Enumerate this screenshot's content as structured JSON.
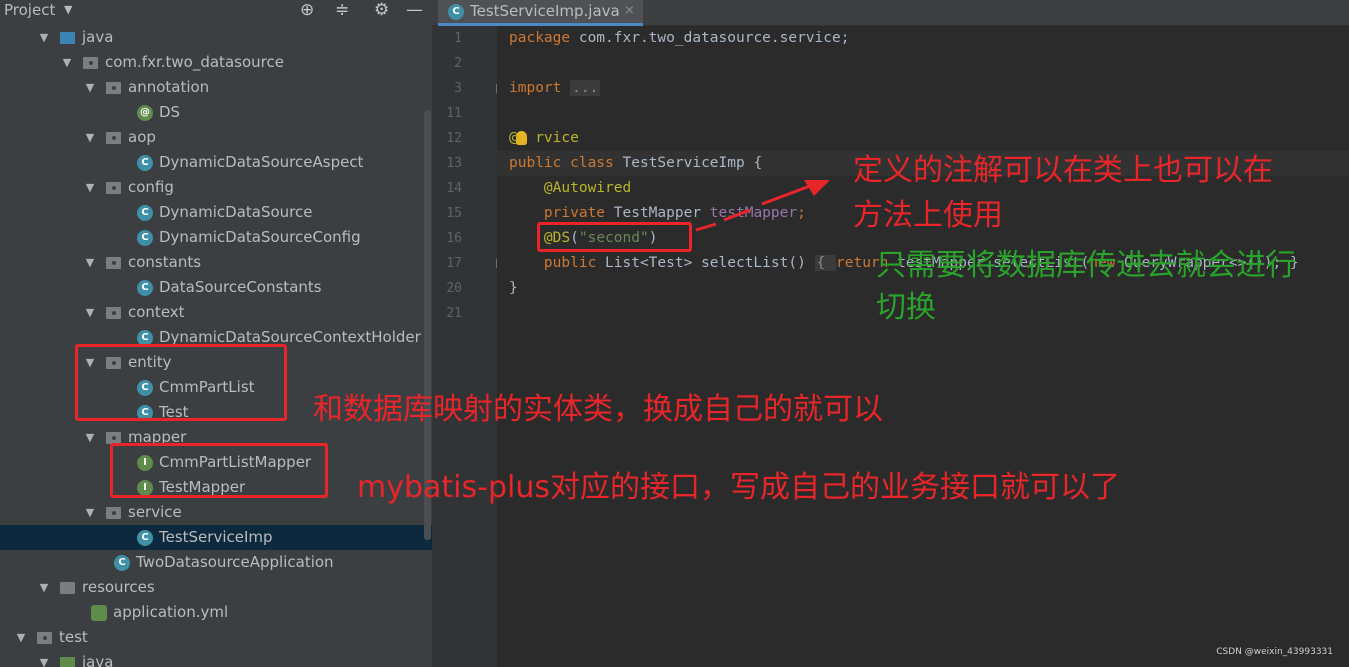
{
  "project_panel": {
    "title": "Project",
    "title_arrow": "▼",
    "header_icons": {
      "locate": "⊕",
      "collapse": "≑",
      "settings": "⚙",
      "hide": "—"
    },
    "tree": [
      {
        "indent": 0,
        "twisty": "▼",
        "icon": "folder-blue",
        "label": "java"
      },
      {
        "indent": 1,
        "twisty": "▼",
        "icon": "package",
        "label": "com.fxr.two_datasource"
      },
      {
        "indent": 2,
        "twisty": "▼",
        "icon": "package",
        "label": "annotation"
      },
      {
        "indent": 3,
        "twisty": "",
        "icon": "annotation",
        "badge": "@",
        "label": "DS"
      },
      {
        "indent": 2,
        "twisty": "▼",
        "icon": "package",
        "label": "aop"
      },
      {
        "indent": 3,
        "twisty": "",
        "icon": "class",
        "badge": "C",
        "label": "DynamicDataSourceAspect"
      },
      {
        "indent": 2,
        "twisty": "▼",
        "icon": "package",
        "label": "config"
      },
      {
        "indent": 3,
        "twisty": "",
        "icon": "class",
        "badge": "C",
        "label": "DynamicDataSource"
      },
      {
        "indent": 3,
        "twisty": "",
        "icon": "class",
        "badge": "C",
        "label": "DynamicDataSourceConfig"
      },
      {
        "indent": 2,
        "twisty": "▼",
        "icon": "package",
        "label": "constants"
      },
      {
        "indent": 3,
        "twisty": "",
        "icon": "class",
        "badge": "C",
        "label": "DataSourceConstants"
      },
      {
        "indent": 2,
        "twisty": "▼",
        "icon": "package",
        "label": "context"
      },
      {
        "indent": 3,
        "twisty": "",
        "icon": "class",
        "badge": "C",
        "label": "DynamicDataSourceContextHolder"
      },
      {
        "indent": 2,
        "twisty": "▼",
        "icon": "package",
        "label": "entity"
      },
      {
        "indent": 3,
        "twisty": "",
        "icon": "class",
        "badge": "C",
        "label": "CmmPartList"
      },
      {
        "indent": 3,
        "twisty": "",
        "icon": "class",
        "badge": "C",
        "label": "Test"
      },
      {
        "indent": 2,
        "twisty": "▼",
        "icon": "package",
        "label": "mapper"
      },
      {
        "indent": 3,
        "twisty": "",
        "icon": "interface",
        "badge": "I",
        "label": "CmmPartListMapper"
      },
      {
        "indent": 3,
        "twisty": "",
        "icon": "interface",
        "badge": "I",
        "label": "TestMapper"
      },
      {
        "indent": 2,
        "twisty": "▼",
        "icon": "package",
        "label": "service"
      },
      {
        "indent": 3,
        "twisty": "",
        "icon": "class",
        "badge": "C",
        "label": "TestServiceImp",
        "selected": true
      },
      {
        "indent": 2,
        "twisty": "",
        "icon": "class",
        "badge": "C",
        "label": "TwoDatasourceApplication"
      },
      {
        "indent": 0,
        "twisty": "▼",
        "icon": "resources",
        "label": "resources"
      },
      {
        "indent": 1,
        "twisty": "",
        "icon": "yml",
        "badge": "",
        "label": "application.yml"
      },
      {
        "indent": -1,
        "twisty": "▼",
        "icon": "folder-gray",
        "label": "test"
      },
      {
        "indent": 0,
        "twisty": "▼",
        "icon": "folder-green",
        "label": "java"
      }
    ]
  },
  "editor": {
    "tab": {
      "label": "TestServiceImp.java",
      "close": "×",
      "badge": "C"
    },
    "lines": [
      {
        "num": "1",
        "tokens": [
          [
            "kw",
            "package "
          ],
          [
            "",
            "com.fxr.two_datasource.service;"
          ]
        ]
      },
      {
        "num": "2",
        "tokens": []
      },
      {
        "num": "3",
        "fold": "+",
        "tokens": [
          [
            "kw",
            "import "
          ],
          [
            "fold-box",
            "..."
          ]
        ]
      },
      {
        "num": "11",
        "tokens": []
      },
      {
        "num": "12",
        "tokens": [
          [
            "an",
            "@"
          ],
          [
            "an",
            "  rvice"
          ]
        ]
      },
      {
        "num": "13",
        "tokens": [
          [
            "kw",
            "public class "
          ],
          [
            "",
            "TestServiceImp {"
          ]
        ]
      },
      {
        "num": "14",
        "tokens": [
          [
            "",
            "    "
          ],
          [
            "an",
            "@Autowired"
          ]
        ]
      },
      {
        "num": "15",
        "tokens": [
          [
            "",
            "    "
          ],
          [
            "kw",
            "private "
          ],
          [
            "",
            "TestMapper "
          ],
          [
            "fld",
            "testMapper"
          ],
          [
            "kw",
            ";"
          ]
        ]
      },
      {
        "num": "16",
        "tokens": [
          [
            "",
            "    "
          ],
          [
            "an",
            "@DS"
          ],
          [
            "",
            "("
          ],
          [
            "str",
            "\"second\""
          ],
          [
            "",
            ")"
          ]
        ]
      },
      {
        "num": "17",
        "fold": "+",
        "tokens": [
          [
            "",
            "    "
          ],
          [
            "kw",
            "public "
          ],
          [
            "",
            "List<Test> selectList() "
          ],
          [
            "fold-box",
            "{ "
          ],
          [
            "kw",
            "return "
          ],
          [
            "",
            "testMapper.selectList("
          ],
          [
            "kw",
            "new "
          ],
          [
            "",
            "QueryWrapper<>()); }"
          ]
        ]
      },
      {
        "num": "20",
        "tokens": [
          [
            "",
            "}"
          ]
        ]
      },
      {
        "num": "21",
        "tokens": []
      }
    ]
  },
  "annotations": {
    "note_ds_1": "定义的注解可以在类上也可以在",
    "note_ds_2": "方法上使用",
    "note_green_1": "只需要将数据库传进去就会进行",
    "note_green_2": "切换",
    "note_entity": "和数据库映射的实体类，换成自己的就可以",
    "note_mapper": "mybatis-plus对应的接口，写成自己的业务接口就可以了"
  },
  "watermark": "CSDN @weixin_43993331",
  "colors": {
    "annotation_red": "#e8262a",
    "annotation_green": "#2aa32a",
    "selection": "#0d293e"
  }
}
